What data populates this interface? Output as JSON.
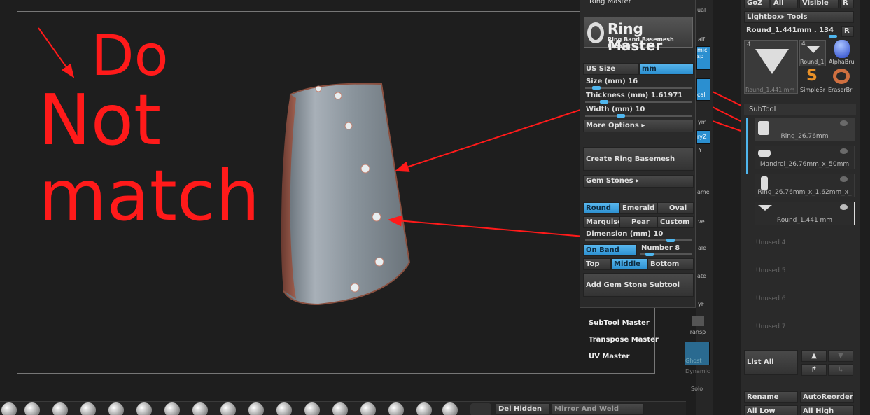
{
  "annotation": {
    "text_line1": "Do",
    "text_line2": "Not",
    "text_line3": "match"
  },
  "colors": {
    "accent": "#4fb6ee",
    "annotation": "#ff1a1a",
    "panel": "#2a2a2a"
  },
  "ring_master": {
    "header": "Ring Master",
    "logo_title": "Ring Master",
    "logo_subtitle": "Ring Band Basemesh Creator",
    "us_size_label": "US Size",
    "unit_label": "mm",
    "size": {
      "label": "Size (mm)",
      "value": "16",
      "fraction": 0.1
    },
    "thickness": {
      "label": "Thickness (mm)",
      "value": "1.61971",
      "fraction": 0.15
    },
    "width": {
      "label": "Width (mm)",
      "value": "10",
      "fraction": 0.3
    },
    "more_options": "More Options",
    "create_button": "Create Ring Basemesh",
    "gem_stones": "Gem Stones",
    "shapes": [
      "Round",
      "Emerald",
      "Oval",
      "Marquise",
      "Pear",
      "Custom"
    ],
    "dimension": {
      "label": "Dimension (mm)",
      "value": "10",
      "fraction": 0.75
    },
    "on_band": "On Band",
    "number": {
      "label": "Number",
      "value": "8",
      "fraction": 0.2
    },
    "positions": [
      "Top",
      "Middle",
      "Bottom"
    ],
    "add_gem_button": "Add Gem Stone Subtool",
    "menu": [
      "SubTool Master",
      "Transpose Master",
      "UV Master"
    ]
  },
  "right_strip": {
    "labels": [
      "ual",
      "alf",
      "mic",
      "sp",
      "cal",
      "ym",
      "ryZ",
      "Y",
      "ame",
      "ve",
      "ale",
      "ate",
      "yF",
      "Transp",
      "Ghost",
      "Dynamic",
      "Solo"
    ]
  },
  "tool_panel": {
    "top_buttons": [
      "GoZ",
      "All",
      "Visible",
      "R"
    ],
    "lightbox": "Lightbox▸ Tools",
    "current_tool": "Round_1.441mm . 134",
    "r_button": "R",
    "thumbs": [
      {
        "name": "Round_1.441 mm",
        "count": "4"
      },
      {
        "name": "Round_1",
        "count": "4"
      },
      {
        "name": "AlphaBru"
      },
      {
        "name": "SimpleBr"
      },
      {
        "name": "EraserBr"
      }
    ],
    "subtool_title": "SubTool",
    "subtools": [
      "Ring_26.76mm",
      "Mandrel_26.76mm_x_50mm",
      "Ring_26.76mm_x_1.62mm_x_",
      "Round_1.441 mm"
    ],
    "unused": [
      "Unused 4",
      "Unused 5",
      "Unused 6",
      "Unused 7"
    ],
    "list_all": "List All",
    "bottom_buttons": [
      "Rename",
      "AutoReorder",
      "All Low",
      "All High"
    ]
  },
  "bottom_bar": {
    "del_hidden": "Del Hidden",
    "mirror_weld": "Mirror And Weld"
  }
}
